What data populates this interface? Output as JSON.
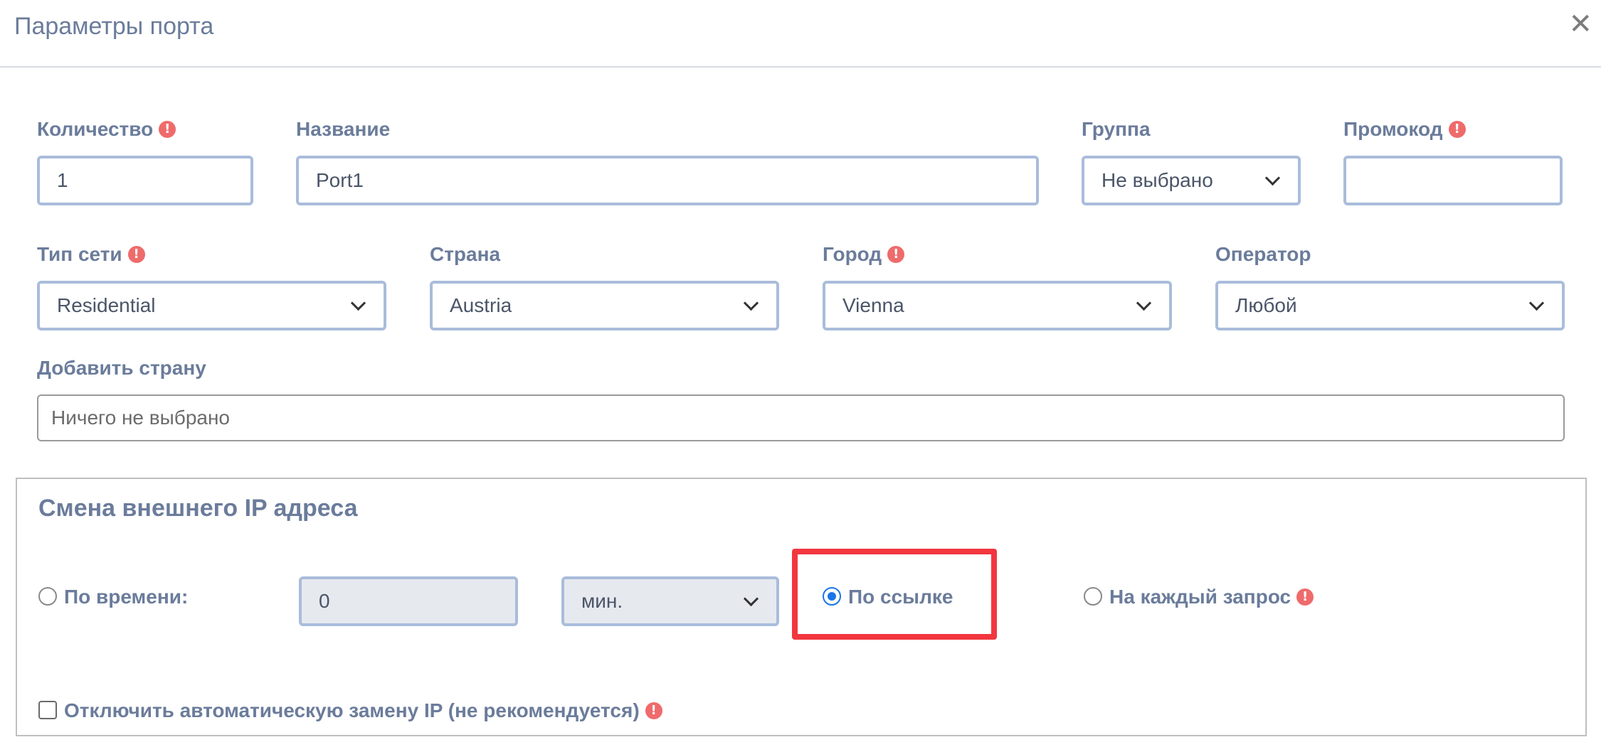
{
  "modal": {
    "title": "Параметры порта",
    "close_label": "✕"
  },
  "form": {
    "quantity": {
      "label": "Количество",
      "value": "1"
    },
    "name": {
      "label": "Название",
      "value": "Port1"
    },
    "group": {
      "label": "Группа",
      "selected": "Не выбрано"
    },
    "promo": {
      "label": "Промокод",
      "value": ""
    },
    "network_type": {
      "label": "Тип сети",
      "selected": "Residential"
    },
    "country": {
      "label": "Страна",
      "selected": "Austria"
    },
    "city": {
      "label": "Город",
      "selected": "Vienna"
    },
    "operator": {
      "label": "Оператор",
      "selected": "Любой"
    },
    "add_country": {
      "label": "Добавить страну",
      "placeholder": "Ничего не выбрано"
    }
  },
  "ip_change": {
    "title": "Смена внешнего IP адреса",
    "by_time": {
      "label": "По времени:",
      "checked": false,
      "value": "0",
      "unit": "мин."
    },
    "by_link": {
      "label": "По ссылке",
      "checked": true
    },
    "per_request": {
      "label": "На каждый запрос",
      "checked": false
    },
    "disable_auto": {
      "label": "Отключить автоматическую замену IP (не рекомендуется)",
      "checked": false
    }
  },
  "icons": {
    "warning": "!",
    "warning_color": "#ef6b6b"
  },
  "colors": {
    "input_border": "#a9bcdb",
    "label_text": "#6b7c9b",
    "highlight": "#f2363f",
    "radio_accent": "#1a73e8"
  }
}
